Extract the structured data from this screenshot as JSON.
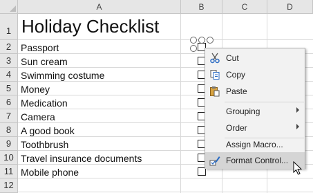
{
  "columns": [
    "A",
    "B",
    "C",
    "D"
  ],
  "rows": [
    "1",
    "2",
    "3",
    "4",
    "5",
    "6",
    "7",
    "8",
    "9",
    "10",
    "11",
    "12"
  ],
  "title": "Holiday Checklist",
  "items": [
    "Passport",
    "Sun cream",
    "Swimming costume",
    "Money",
    "Medication",
    "Camera",
    "A good book",
    "Toothbrush",
    "Travel insurance documents",
    "Mobile phone"
  ],
  "menu": {
    "cut": "Cut",
    "copy": "Copy",
    "paste": "Paste",
    "grouping": "Grouping",
    "order": "Order",
    "assign_macro": "Assign Macro...",
    "format_control": "Format Control..."
  },
  "icons": {
    "cut": "scissors-icon",
    "copy": "copy-icon",
    "paste": "paste-icon",
    "format_control": "format-control-icon",
    "cursor": "mouse-pointer-icon"
  },
  "colors": {
    "header_bg": "#e6e6e6",
    "menu_bg": "#f2f2f2",
    "menu_highlight": "#d5d5d5",
    "icon_blue": "#2b6cc4"
  }
}
